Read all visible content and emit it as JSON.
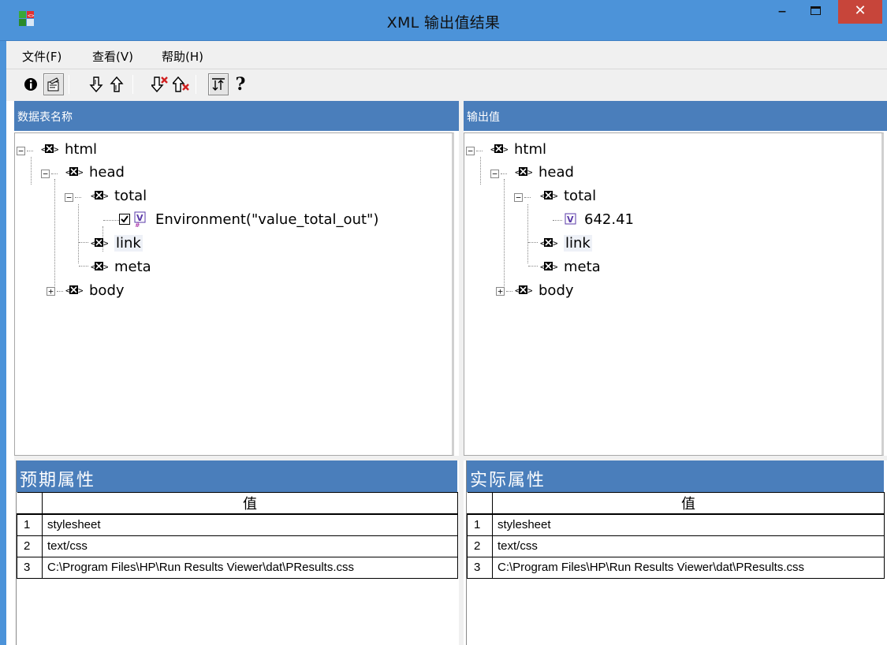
{
  "window": {
    "title": "XML 输出值结果",
    "minimize": "–",
    "close": "✕"
  },
  "menu": [
    "文件(F)",
    "查看(V)",
    "帮助(H)"
  ],
  "toolbar": {
    "buttons": [
      "info-icon",
      "properties-icon",
      "next-down-icon",
      "next-up-icon",
      "next-error-down-icon",
      "next-error-up-icon",
      "sort-icon",
      "help-icon"
    ],
    "help_glyph": "?"
  },
  "left_panel": {
    "title": "数据表名称",
    "nodes": {
      "html": "html",
      "head": "head",
      "total": "total",
      "value": "Environment(\"value_total_out\")",
      "link": "link",
      "meta": "meta",
      "body": "body"
    }
  },
  "right_panel": {
    "title": "输出值",
    "nodes": {
      "html": "html",
      "head": "head",
      "total": "total",
      "value": "642.41",
      "link": "link",
      "meta": "meta",
      "body": "body"
    }
  },
  "expected_props": {
    "title": "预期属性",
    "column": "值",
    "rows": [
      {
        "index": "1",
        "value": "stylesheet"
      },
      {
        "index": "2",
        "value": "text/css"
      },
      {
        "index": "3",
        "value": "C:\\Program Files\\HP\\Run Results Viewer\\dat\\PResults.css"
      }
    ]
  },
  "actual_props": {
    "title": "实际属性",
    "column": "值",
    "rows": [
      {
        "index": "1",
        "value": "stylesheet"
      },
      {
        "index": "2",
        "value": "text/css"
      },
      {
        "index": "3",
        "value": "C:\\Program Files\\HP\\Run Results Viewer\\dat\\PResults.css"
      }
    ]
  },
  "colors": {
    "titlebar": "#4c93d9",
    "panel_header": "#4a7ebb",
    "close_button": "#c7453a"
  }
}
